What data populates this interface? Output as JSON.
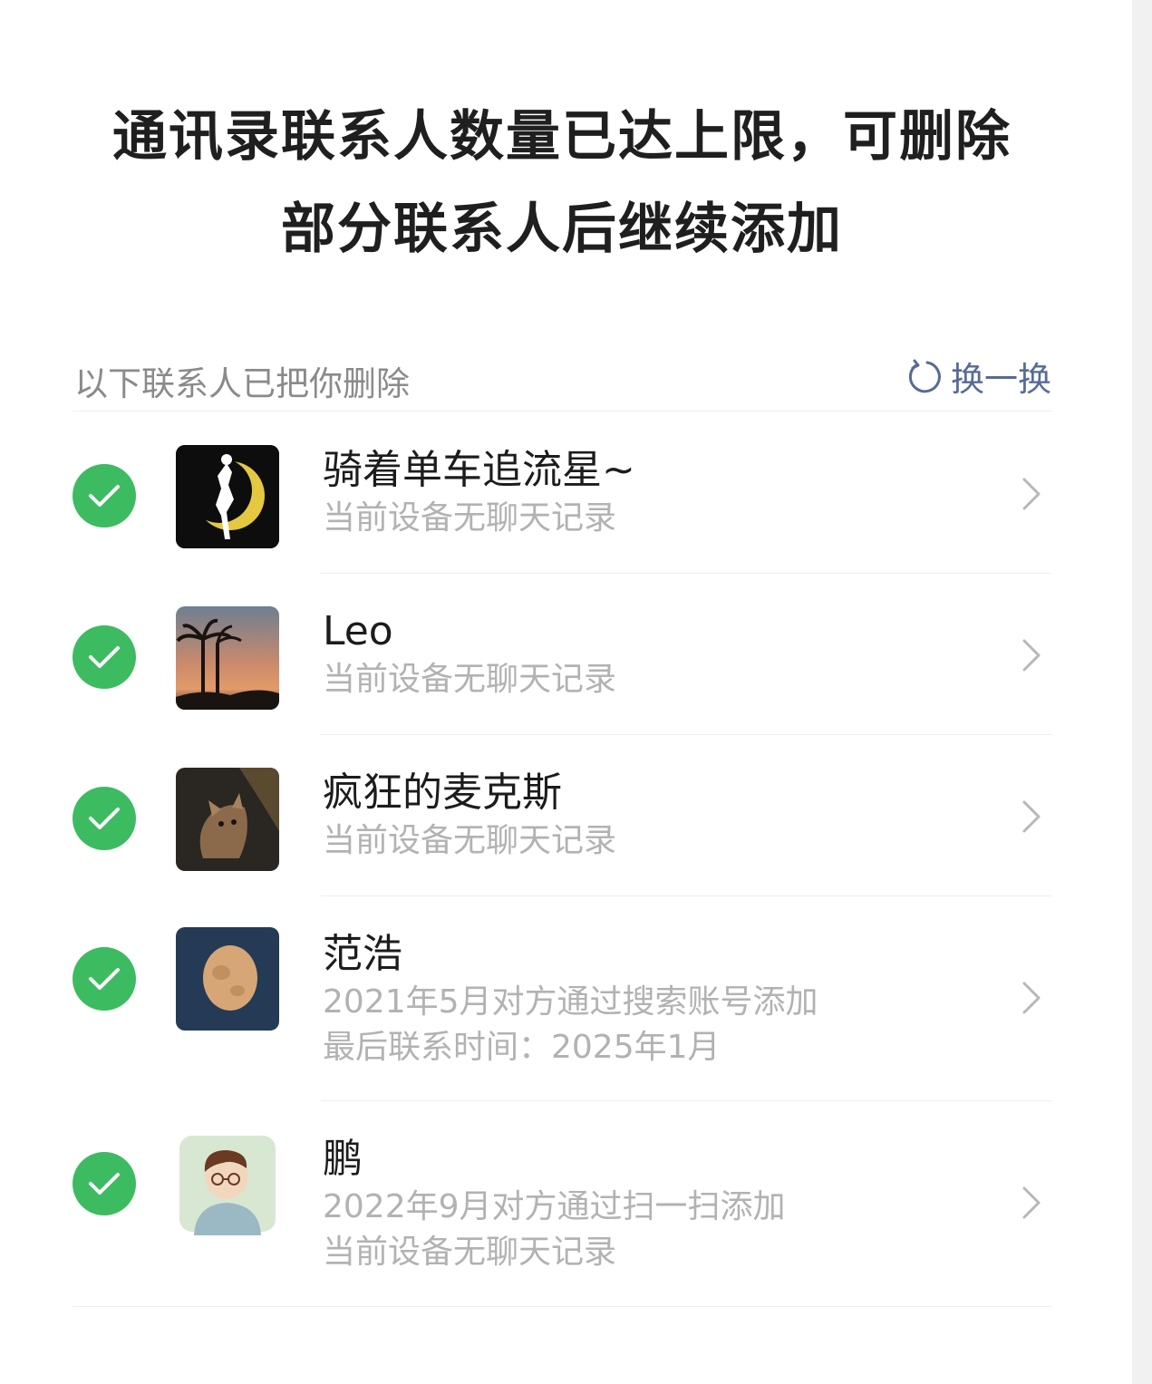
{
  "headline": {
    "line1": "通讯录联系人数量已达上限，可删除",
    "line2": "部分联系人后继续添加"
  },
  "section": {
    "title": "以下联系人已把你删除",
    "refresh_label": "换一换"
  },
  "contacts": [
    {
      "name": "骑着单车追流星~",
      "lines": [
        "当前设备无聊天记录"
      ],
      "checked": true
    },
    {
      "name": "Leo",
      "lines": [
        "当前设备无聊天记录"
      ],
      "checked": true
    },
    {
      "name": "疯狂的麦克斯",
      "lines": [
        "当前设备无聊天记录"
      ],
      "checked": true
    },
    {
      "name": "范浩",
      "lines": [
        "2021年5月对方通过搜索账号添加",
        "最后联系时间：2025年1月"
      ],
      "checked": true
    },
    {
      "name": "鹏",
      "lines": [
        "2022年9月对方通过扫一扫添加",
        "当前设备无聊天记录"
      ],
      "checked": true
    }
  ],
  "colors": {
    "check_green": "#3dbb61",
    "link_blue": "#576b95",
    "secondary_text": "#b2b2b2"
  }
}
